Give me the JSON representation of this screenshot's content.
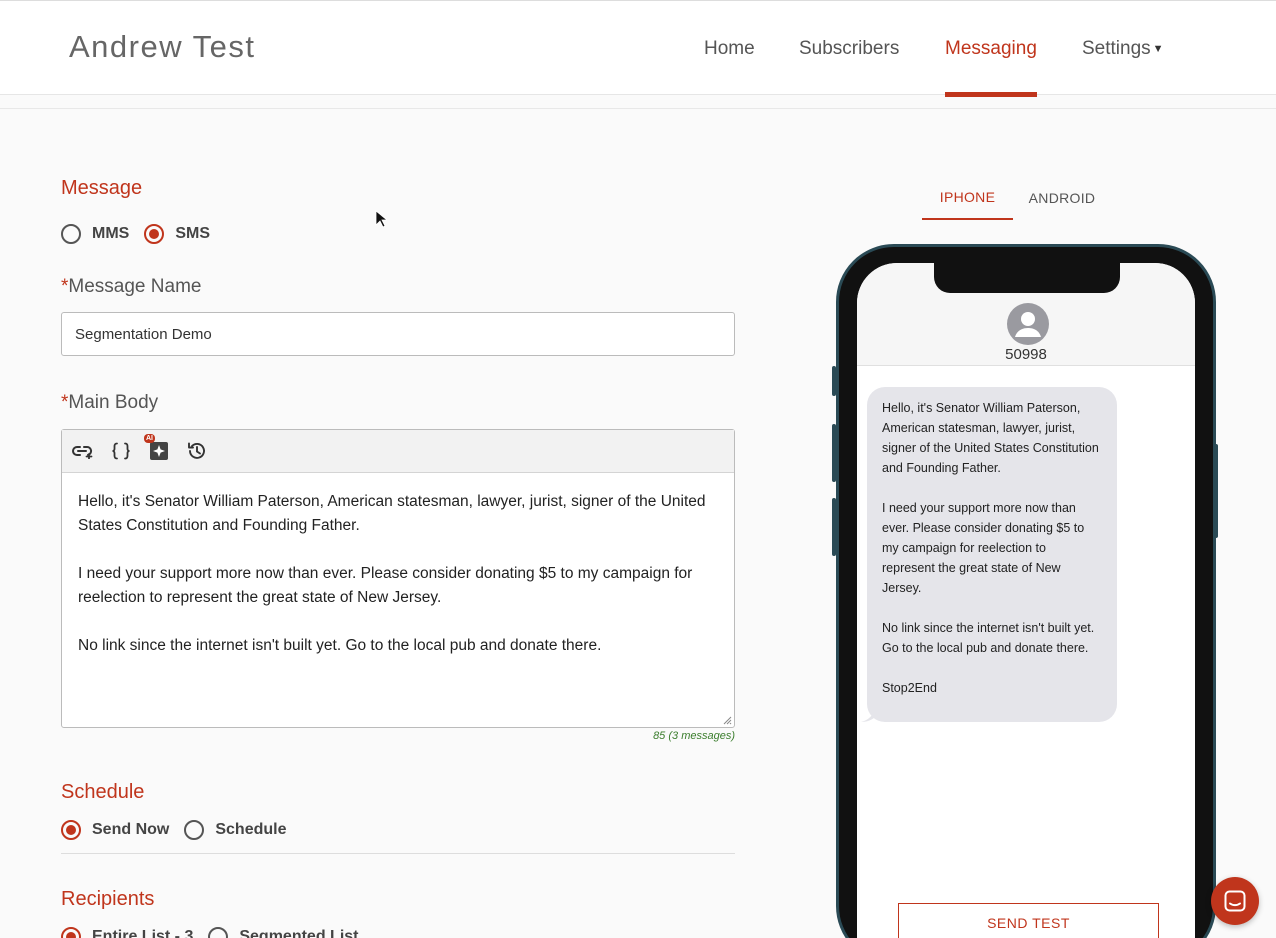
{
  "header": {
    "brand": "Andrew Test",
    "nav": [
      "Home",
      "Subscribers",
      "Messaging",
      "Settings"
    ],
    "active_nav": "Messaging"
  },
  "message": {
    "section_title": "Message",
    "type_options": [
      "MMS",
      "SMS"
    ],
    "selected_type": "SMS",
    "name_label": "Message Name",
    "name_value": "Segmentation Demo",
    "body_label": "Main Body",
    "body_paragraphs": [
      "Hello, it's Senator William Paterson, American statesman, lawyer, jurist, signer of the United States Constitution and Founding Father.",
      "I need your support more now than ever.  Please consider donating $5 to my campaign for reelection to represent the great state of New Jersey.",
      "No link since the internet isn't built yet. Go to the local pub and donate there."
    ],
    "ai_badge": "AI",
    "char_counter": "85 (3 messages)"
  },
  "schedule": {
    "section_title": "Schedule",
    "options": [
      "Send Now",
      "Schedule"
    ],
    "selected": "Send Now"
  },
  "recipients": {
    "section_title": "Recipients",
    "options": [
      "Entire List - 3",
      "Segmented List"
    ],
    "selected": "Entire List - 3"
  },
  "preview": {
    "tabs": [
      "IPHONE",
      "ANDROID"
    ],
    "active_tab": "IPHONE",
    "short_code": "50998",
    "bubble_paragraphs": [
      "Hello, it's Senator William Paterson, American statesman, lawyer, jurist, signer of the United States Constitution and Founding Father.",
      "I need your support more now than ever.  Please consider donating $5 to my campaign for reelection to represent the great state of New Jersey.",
      "No link since the internet isn't built yet. Go to the local pub and donate there.",
      "Stop2End"
    ],
    "send_test_label": "SEND TEST"
  },
  "colors": {
    "accent": "#c0351c",
    "counter_green": "#3a7d2c",
    "bubble_gray": "#e5e5ea"
  },
  "icons": [
    "link-plus-icon",
    "braces-icon",
    "ai-sparkle-icon",
    "history-icon",
    "user-avatar-icon",
    "chat-icon",
    "mouse-cursor-icon"
  ]
}
